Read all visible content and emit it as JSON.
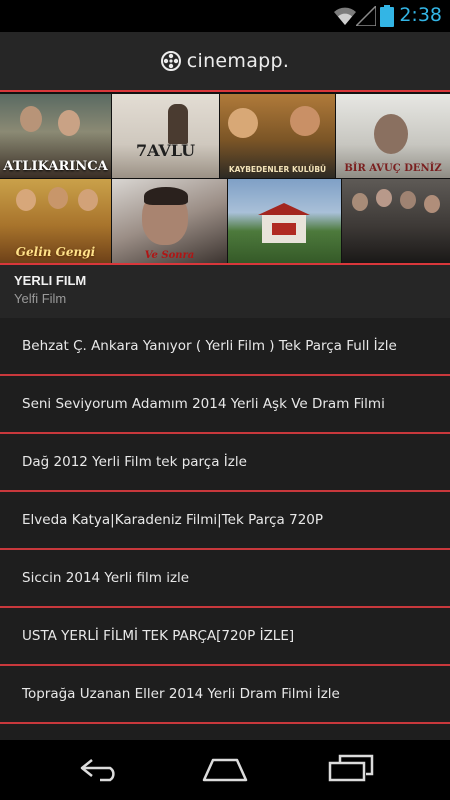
{
  "status": {
    "time": "2:38"
  },
  "app": {
    "name": "cinemapp."
  },
  "banner": {
    "posters": [
      {
        "title": "ATLIKARINCA",
        "icon": "poster-atlikarinca"
      },
      {
        "title": "7AVLU",
        "icon": "poster-7avlu"
      },
      {
        "title": "KAYBEDENLER KULÜBÜ",
        "icon": "poster-kaybedenler"
      },
      {
        "title": "BİR AVUÇ DENİZ",
        "icon": "poster-bir-avuc-deniz"
      },
      {
        "title": "Gelin Gengi",
        "icon": "poster-gelin"
      },
      {
        "title": "Ve Sonra",
        "icon": "poster-deniz"
      },
      {
        "title": "",
        "icon": "poster-landscape"
      },
      {
        "title": "",
        "icon": "poster-group"
      }
    ]
  },
  "category": {
    "title": "YERLI FILM",
    "subtitle": "Yelfi Film"
  },
  "items": [
    "Behzat Ç. Ankara Yanıyor ( Yerli Film ) Tek Parça Full İzle",
    "Seni Seviyorum Adamım 2014 Yerli Aşk Ve Dram Filmi",
    "Dağ 2012 Yerli Film tek parça İzle",
    "Elveda Katya|Karadeniz Filmi|Tek Parça 720P",
    "Siccin 2014 Yerli film izle",
    "USTA YERLİ FİLMİ TEK PARÇA[720P İZLE]",
    "Toprağa Uzanan Eller 2014 Yerli Dram Filmi İzle"
  ],
  "nav": {
    "back_icon": "back-icon",
    "home_icon": "home-icon",
    "recents_icon": "recent-apps-icon"
  }
}
